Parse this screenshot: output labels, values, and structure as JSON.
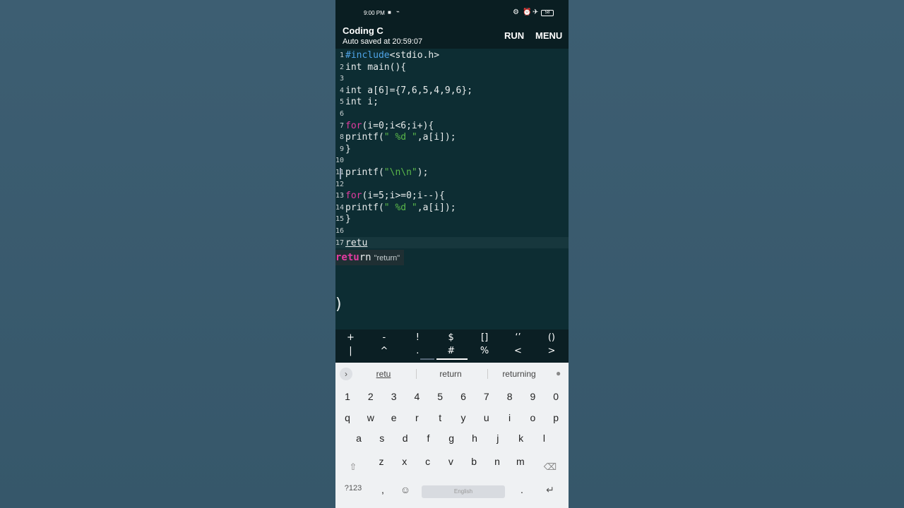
{
  "status_bar": {
    "time": "9:00 PM",
    "video_icon": "video-icon",
    "icons": [
      "vpn-icon",
      "alarm-icon",
      "airplane-icon"
    ],
    "battery": "58"
  },
  "app_bar": {
    "title": "Coding C",
    "subtitle": "Auto saved at 20:59:07",
    "run_label": "RUN",
    "menu_label": "MENU"
  },
  "editor": {
    "lines": [
      {
        "n": "1",
        "tokens": [
          {
            "t": "#include",
            "c": "pp"
          },
          {
            "t": "<stdio.h>",
            "c": ""
          }
        ]
      },
      {
        "n": "2",
        "tokens": [
          {
            "t": "int",
            "c": "ty"
          },
          {
            "t": " main(){",
            "c": ""
          }
        ]
      },
      {
        "n": "3",
        "tokens": []
      },
      {
        "n": "4",
        "tokens": [
          {
            "t": "int",
            "c": "ty"
          },
          {
            "t": " a[6]={7,6,5,4,9,6};",
            "c": ""
          }
        ]
      },
      {
        "n": "5",
        "tokens": [
          {
            "t": "int",
            "c": "ty"
          },
          {
            "t": " i;",
            "c": ""
          }
        ]
      },
      {
        "n": "6",
        "tokens": []
      },
      {
        "n": "7",
        "tokens": [
          {
            "t": "for",
            "c": "kw"
          },
          {
            "t": "(i=0;i<6;i+){",
            "c": ""
          }
        ]
      },
      {
        "n": "8",
        "tokens": [
          {
            "t": "printf(",
            "c": ""
          },
          {
            "t": "\" %d \"",
            "c": "str"
          },
          {
            "t": ",a[i]);",
            "c": ""
          }
        ]
      },
      {
        "n": "9",
        "tokens": [
          {
            "t": "}",
            "c": ""
          }
        ]
      },
      {
        "n": "10",
        "tokens": []
      },
      {
        "n": "11",
        "tokens": [
          {
            "t": "printf(",
            "c": ""
          },
          {
            "t": "\"\\n\\n\"",
            "c": "str"
          },
          {
            "t": ");",
            "c": ""
          }
        ]
      },
      {
        "n": "12",
        "tokens": []
      },
      {
        "n": "13",
        "tokens": [
          {
            "t": "for",
            "c": "kw"
          },
          {
            "t": "(i=5;i>=0;i--){",
            "c": ""
          }
        ]
      },
      {
        "n": "14",
        "tokens": [
          {
            "t": "printf(",
            "c": ""
          },
          {
            "t": "\" %d \"",
            "c": "str"
          },
          {
            "t": ",a[i]);",
            "c": ""
          }
        ]
      },
      {
        "n": "15",
        "tokens": [
          {
            "t": "}",
            "c": ""
          }
        ]
      },
      {
        "n": "16",
        "tokens": []
      },
      {
        "n": "17",
        "tokens": [
          {
            "t": "retu",
            "c": ""
          }
        ],
        "current": true
      }
    ],
    "suggestion": {
      "match": "retu",
      "rest": "rn",
      "hint": "\"return\""
    },
    "stray_glyph": ")"
  },
  "symbol_bar": {
    "row1": [
      "+",
      "-",
      "!",
      "$",
      "[]",
      "‘’",
      "()"
    ],
    "row2": [
      "|",
      "^",
      ".",
      "#",
      "%",
      "<",
      ">"
    ]
  },
  "keyboard": {
    "suggestions": [
      "retu",
      "return",
      "returning"
    ],
    "numbers": [
      "1",
      "2",
      "3",
      "4",
      "5",
      "6",
      "7",
      "8",
      "9",
      "0"
    ],
    "row_q": [
      "q",
      "w",
      "e",
      "r",
      "t",
      "y",
      "u",
      "i",
      "o",
      "p"
    ],
    "row_a": [
      "a",
      "s",
      "d",
      "f",
      "g",
      "h",
      "j",
      "k",
      "l"
    ],
    "row_z": [
      "z",
      "x",
      "c",
      "v",
      "b",
      "n",
      "m"
    ],
    "shift_icon": "shift-icon",
    "backspace_icon": "backspace-icon",
    "sym_label": "?123",
    "comma": ",",
    "emoji_icon": "emoji-icon",
    "space_label": "English",
    "period": ".",
    "enter_icon": "enter-icon",
    "mic_icon": "mic-icon",
    "expand_icon": "chevron-right-icon"
  }
}
